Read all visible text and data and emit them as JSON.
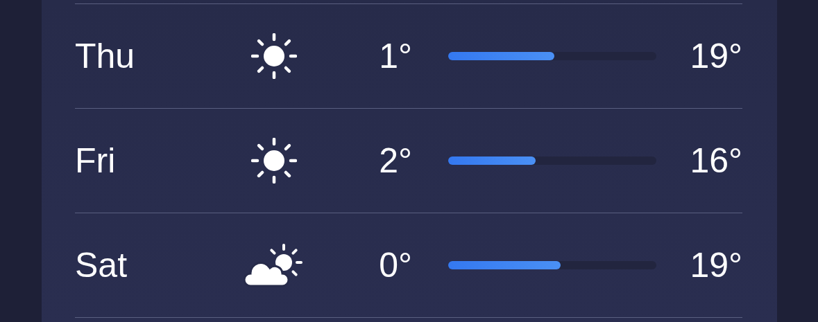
{
  "days": [
    {
      "day": "Thu",
      "kind": "sun",
      "low": "1°",
      "level": 0.51,
      "high": "19°"
    },
    {
      "day": "Fri",
      "kind": "sun",
      "low": "2°",
      "level": 0.42,
      "high": "16°"
    },
    {
      "day": "Sat",
      "kind": "partly-cloudy",
      "low": "0°",
      "level": 0.54,
      "high": "19°"
    }
  ]
}
